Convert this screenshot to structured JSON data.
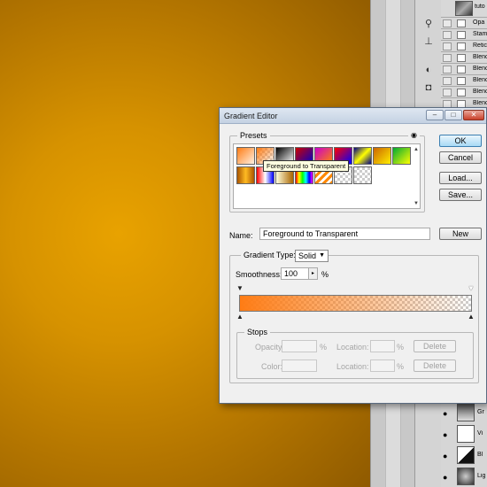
{
  "layers_panel": {
    "top_layer_name": "tuto",
    "rows": [
      "Opa",
      "Stam",
      "Retic",
      "Blenc",
      "Blenc",
      "Blenc",
      "Blenc",
      "Blenc",
      "Blen"
    ],
    "bottom_rows": [
      "Gr",
      "Vi",
      "Bl",
      "Lig"
    ]
  },
  "dialog": {
    "title": "Gradient Editor",
    "presets_label": "Presets",
    "tooltip": "Foreground to Transparent",
    "buttons": {
      "ok": "OK",
      "cancel": "Cancel",
      "load": "Load...",
      "save": "Save...",
      "new": "New"
    },
    "name_label": "Name:",
    "name_value": "Foreground to Transparent",
    "gradient_type_group": "Gradient Type:",
    "gradient_type_value": "Solid",
    "smoothness_label": "Smoothness:",
    "smoothness_value": "100",
    "smoothness_unit": "%",
    "stops_group": "Stops",
    "opacity_label": "Opacity:",
    "color_label": "Color:",
    "location_label": "Location:",
    "percent": "%",
    "delete_label": "Delete"
  },
  "gradient": {
    "start_color": "#ff7c14",
    "start_opacity": 1.0,
    "end_opacity": 0.0
  },
  "colors": {
    "canvas_center": "#e8a200",
    "canvas_edge": "#8f5a00",
    "ok_accent": "#a7d9f5"
  }
}
